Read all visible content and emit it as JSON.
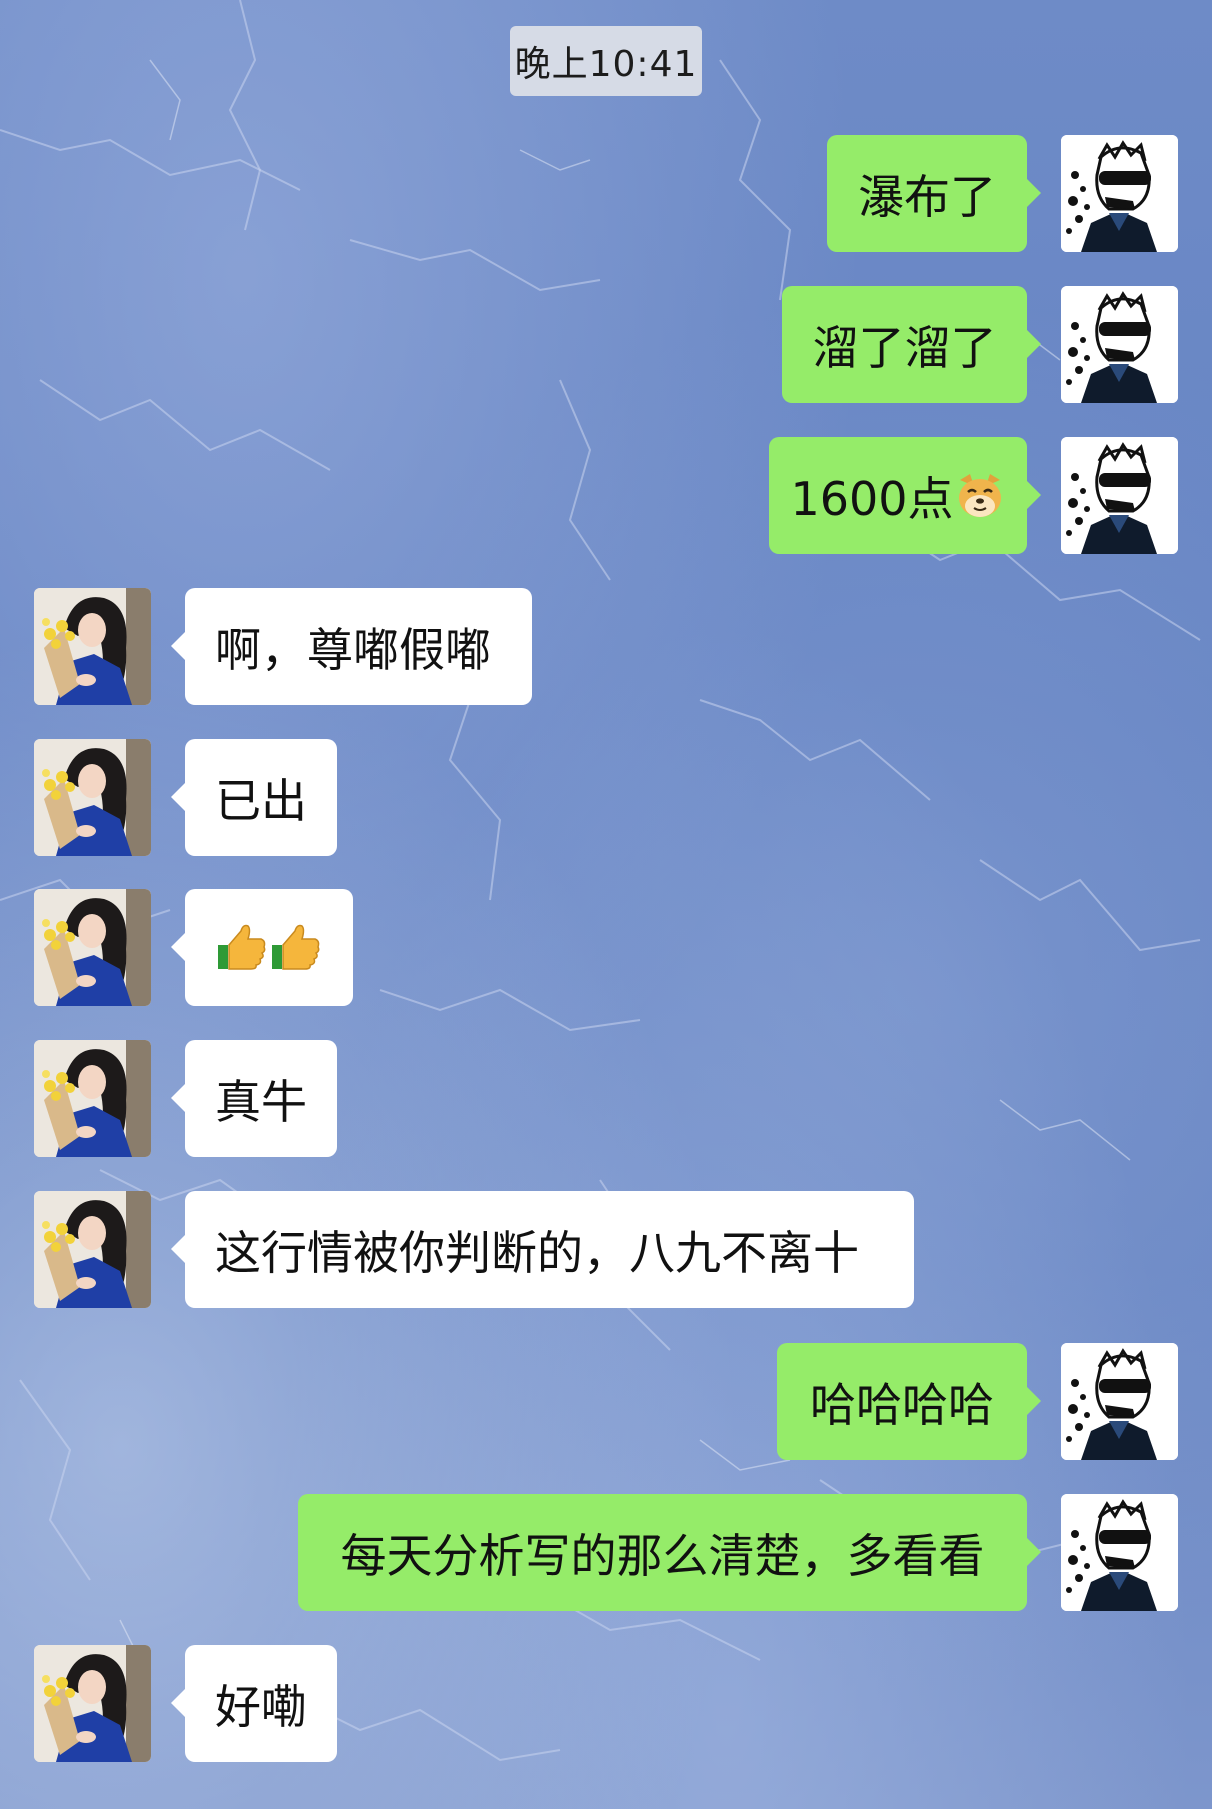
{
  "chat": {
    "timestamp": "晚上10:41",
    "colors": {
      "sent_bubble": "#95ec69",
      "received_bubble": "#ffffff",
      "background": "#6a87c4"
    },
    "messages": [
      {
        "side": "right",
        "text": "瀑布了"
      },
      {
        "side": "right",
        "text": "溜了溜了"
      },
      {
        "side": "right",
        "text": "1600点",
        "emoji": "doge-emoji"
      },
      {
        "side": "left",
        "text": "啊，尊嘟假嘟"
      },
      {
        "side": "left",
        "text": "已出"
      },
      {
        "side": "left",
        "text": "",
        "emoji": "thumbs-up-emoji x2"
      },
      {
        "side": "left",
        "text": "真牛"
      },
      {
        "side": "left",
        "text": "这行情被你判断的，八九不离十"
      },
      {
        "side": "right",
        "text": "哈哈哈哈"
      },
      {
        "side": "right",
        "text": "每天分析写的那么清楚，多看看"
      },
      {
        "side": "left",
        "text": "好嘞"
      }
    ]
  }
}
